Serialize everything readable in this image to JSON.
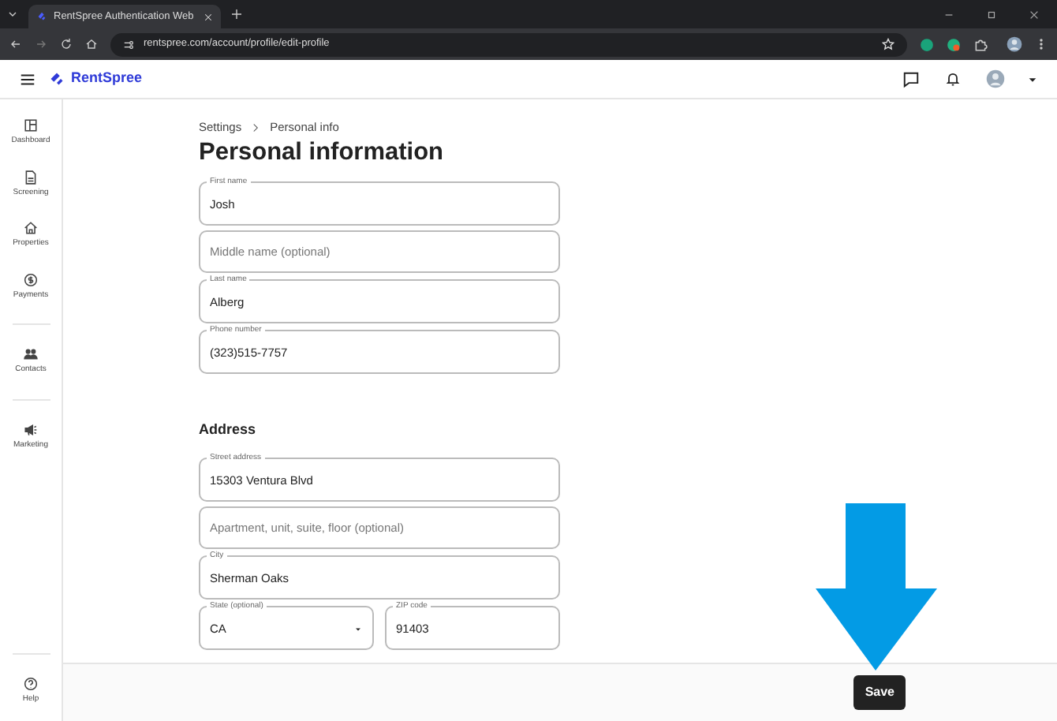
{
  "browser": {
    "tab_title": "RentSpree Authentication Web",
    "url": "rentspree.com/account/profile/edit-profile"
  },
  "header": {
    "logo": "RentSpree"
  },
  "sidebar": {
    "groups": [
      [
        {
          "label": "Dashboard",
          "kind": "dashboard"
        },
        {
          "label": "Screening",
          "kind": "screening"
        },
        {
          "label": "Properties",
          "kind": "properties"
        },
        {
          "label": "Payments",
          "kind": "payments"
        }
      ],
      [
        {
          "label": "Contacts",
          "kind": "contacts"
        }
      ],
      [
        {
          "label": "Marketing",
          "kind": "marketing"
        }
      ]
    ],
    "help": {
      "label": "Help"
    }
  },
  "breadcrumb": [
    "Settings",
    "Personal info"
  ],
  "title": "Personal information",
  "personal_fields": [
    {
      "label": "First name",
      "value": "Josh"
    },
    {
      "placeholder": "Middle name (optional)"
    },
    {
      "label": "Last name",
      "value": "Alberg"
    },
    {
      "label": "Phone number",
      "value": "(323)515-7757"
    }
  ],
  "address": {
    "heading": "Address",
    "fields": [
      {
        "kind": "text",
        "label": "Street address",
        "value": "15303 Ventura Blvd"
      },
      {
        "kind": "text",
        "placeholder": "Apartment, unit, suite, floor (optional)"
      },
      {
        "kind": "text",
        "label": "City",
        "value": "Sherman Oaks"
      },
      {
        "kind": "select",
        "label": "State (optional)",
        "value": "CA"
      },
      {
        "kind": "text",
        "label": "ZIP code",
        "value": "91403"
      }
    ]
  },
  "save_button": "Save"
}
